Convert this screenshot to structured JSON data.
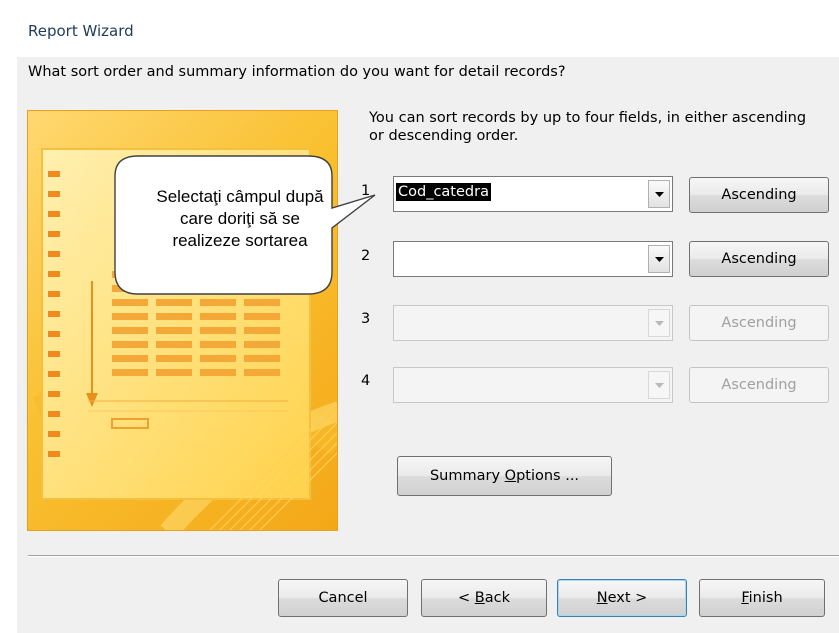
{
  "window": {
    "title": "Report Wizard"
  },
  "dialog": {
    "question": "What sort order and summary information do you want for detail records?",
    "description": "You can sort records by up to four fields, in either ascending or descending order."
  },
  "sort_fields": [
    {
      "number": "1",
      "value": "Cod_catedra",
      "order": "Ascending",
      "enabled": true
    },
    {
      "number": "2",
      "value": "",
      "order": "Ascending",
      "enabled": true
    },
    {
      "number": "3",
      "value": "",
      "order": "Ascending",
      "enabled": false
    },
    {
      "number": "4",
      "value": "",
      "order": "Ascending",
      "enabled": false
    }
  ],
  "summary_button": {
    "pre": "Summary ",
    "hotkey": "O",
    "post": "ptions ..."
  },
  "callout": {
    "line1": "Selectaţi câmpul după",
    "line2": "care doriţi să se",
    "line3": "realizeze sortarea"
  },
  "footer": {
    "cancel": "Cancel",
    "back": {
      "pre": "< ",
      "hotkey": "B",
      "post": "ack"
    },
    "next": {
      "pre": "",
      "hotkey": "N",
      "post": "ext >"
    },
    "finish": {
      "pre": "",
      "hotkey": "F",
      "post": "inish"
    }
  },
  "colors": {
    "art_orange": "#f4a818",
    "art_light": "#ffe28a",
    "default_button": "#3c7fb1"
  },
  "icons": {
    "dropdown": "chevron-down-icon"
  }
}
